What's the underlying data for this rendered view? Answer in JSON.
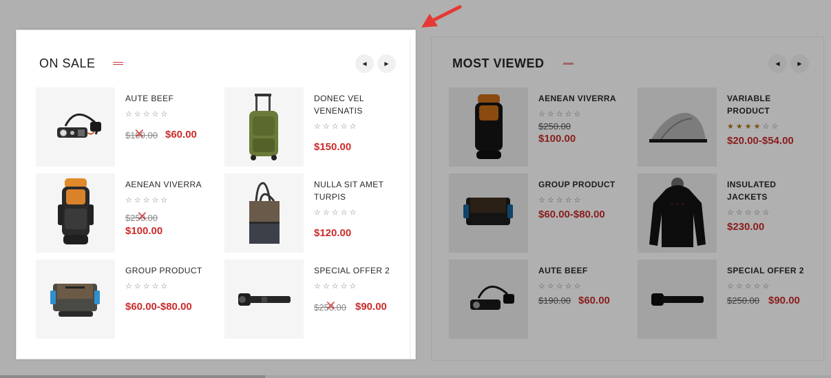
{
  "on_sale": {
    "title": "ON SALE",
    "prev_label": "◀",
    "next_label": "▶",
    "products": [
      {
        "name": "AUTE BEEF",
        "stars": "☆☆☆☆☆",
        "old_price": "$190.00",
        "price": "$60.00",
        "image": "headlamp-image"
      },
      {
        "name": "DONEC VEL VENENATIS",
        "stars": "☆☆☆☆☆",
        "old_price": "",
        "price": "$150.00",
        "image": "luggage-image"
      },
      {
        "name": "AENEAN VIVERRA",
        "stars": "☆☆☆☆☆",
        "old_price": "$250.00",
        "price": "$100.00",
        "image": "backpack-image"
      },
      {
        "name": "NULLA SIT AMET TURPIS",
        "stars": "☆☆☆☆☆",
        "old_price": "",
        "price": "$120.00",
        "image": "tote-bag-image"
      },
      {
        "name": "GROUP PRODUCT",
        "stars": "☆☆☆☆☆",
        "old_price": "",
        "price": "$60.00-$80.00",
        "image": "messenger-bag-image"
      },
      {
        "name": "SPECIAL OFFER 2",
        "stars": "☆☆☆☆☆",
        "old_price": "$250.00",
        "price": "$90.00",
        "image": "flashlight-image"
      }
    ]
  },
  "most_viewed": {
    "title": "MOST VIEWED",
    "prev_label": "◀",
    "next_label": "▶",
    "products": [
      {
        "name": "AENEAN VIVERRA",
        "stars": "☆☆☆☆☆",
        "old_price": "$250.00",
        "price": "$100.00",
        "image": "backpack-image"
      },
      {
        "name": "VARIABLE PRODUCT",
        "stars_filled": "★★★★",
        "stars_empty": "☆☆",
        "rating": 4,
        "old_price": "",
        "price": "$20.00-$54.00",
        "image": "tent-image"
      },
      {
        "name": "GROUP PRODUCT",
        "stars": "☆☆☆☆☆",
        "old_price": "",
        "price": "$60.00-$80.00",
        "image": "messenger-bag-image"
      },
      {
        "name": "INSULATED JACKETS",
        "stars": "☆☆☆☆☆",
        "old_price": "",
        "price": "$230.00",
        "image": "hoodie-image"
      },
      {
        "name": "AUTE BEEF",
        "stars": "☆☆☆☆☆",
        "old_price": "$190.00",
        "price": "$60.00",
        "image": "headlamp-image"
      },
      {
        "name": "SPECIAL OFFER 2",
        "stars": "☆☆☆☆☆",
        "old_price": "$250.00",
        "price": "$90.00",
        "image": "flashlight-image"
      }
    ]
  },
  "colors": {
    "accent": "#cc2b2b",
    "overlay": "#b0b0b0",
    "arrow": "#e53935"
  },
  "annotation": {
    "icon": "pointer-arrow-icon"
  }
}
